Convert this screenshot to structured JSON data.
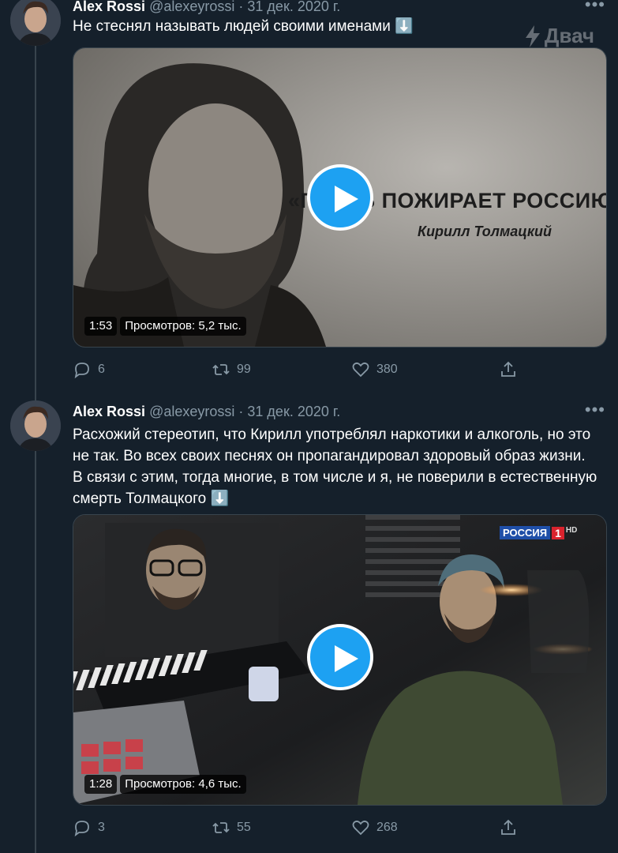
{
  "watermark": {
    "text": "Двач",
    "icon": "bolt-icon"
  },
  "tweets": [
    {
      "author_name": "Alex Rossi",
      "handle": "@alexeyrossi",
      "separator": "·",
      "date": "31 дек. 2020 г.",
      "more": "•••",
      "text": "Не стеснял называть людей своими именами ⬇️",
      "video": {
        "duration": "1:53",
        "views": "Просмотров: 5,2 тыс.",
        "caption_quote": "«ГНИЛЬ ПОЖИРАЕТ РОССИЮ»",
        "caption_author": "Кирилл Толмацкий"
      },
      "counts": {
        "replies": "6",
        "retweets": "99",
        "likes": "380"
      }
    },
    {
      "author_name": "Alex Rossi",
      "handle": "@alexeyrossi",
      "separator": "·",
      "date": "31 дек. 2020 г.",
      "more": "•••",
      "text": "Расхожий стереотип, что Кирилл употреблял наркотики и алкоголь, но это не так. Во всех своих песнях он пропагандировал здоровый образ жизни. В связи с этим, тогда многие, в том числе и я, не поверили в естественную смерть Толмацкого ⬇️",
      "video": {
        "duration": "1:28",
        "views": "Просмотров: 4,6 тыс.",
        "channel_logo": "РОССИЯ",
        "channel_number": "1",
        "channel_hd": "HD"
      },
      "counts": {
        "replies": "3",
        "retweets": "55",
        "likes": "268"
      }
    }
  ],
  "icons": {
    "reply": "reply-icon",
    "retweet": "retweet-icon",
    "like": "heart-icon",
    "share": "share-icon"
  },
  "colors": {
    "background": "#15202b",
    "accent": "#1da1f2",
    "muted": "#8899a6",
    "border": "#38444d"
  }
}
